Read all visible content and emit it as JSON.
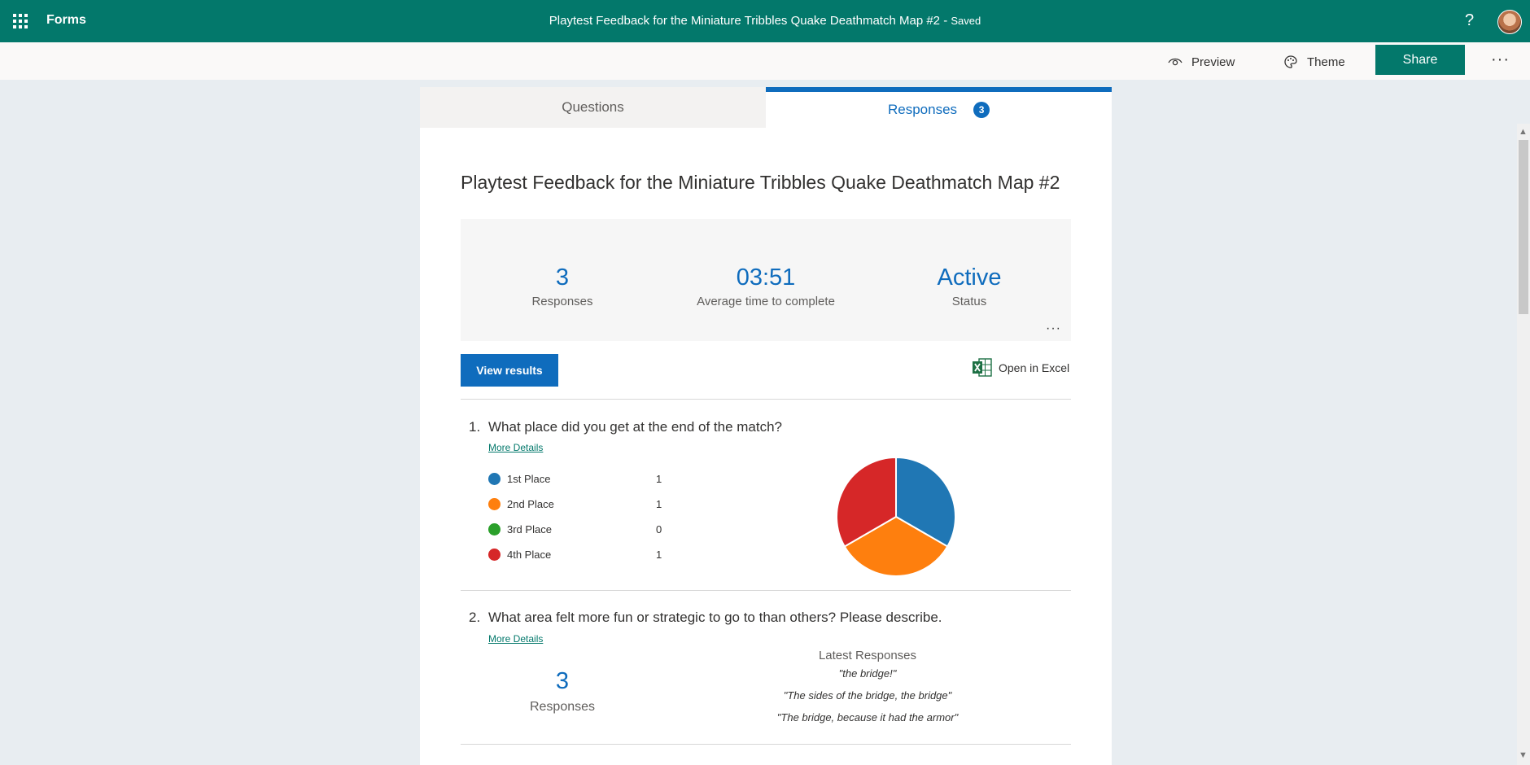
{
  "topbar": {
    "app_name": "Forms",
    "form_title": "Playtest Feedback for the Miniature Tribbles Quake Deathmatch Map #2",
    "save_status": "Saved",
    "help_label": "?"
  },
  "commandbar": {
    "preview_label": "Preview",
    "theme_label": "Theme",
    "share_label": "Share",
    "more_label": "···"
  },
  "tabs": {
    "questions_label": "Questions",
    "responses_label": "Responses",
    "responses_badge": "3"
  },
  "summary": {
    "title": "Playtest Feedback for the Miniature Tribbles Quake Deathmatch Map #2",
    "responses_count": "3",
    "responses_label": "Responses",
    "avg_time": "03:51",
    "avg_time_label": "Average time to complete",
    "status": "Active",
    "status_label": "Status",
    "more_label": "···",
    "view_results_label": "View results",
    "open_excel_label": "Open in Excel"
  },
  "questions": [
    {
      "number": "1.",
      "text": "What place did you get at the end of the match?",
      "more_details": "More Details",
      "options": [
        {
          "label": "1st Place",
          "count": "1",
          "color": "#2077b4"
        },
        {
          "label": "2nd Place",
          "count": "1",
          "color": "#fe7f0e"
        },
        {
          "label": "3rd Place",
          "count": "0",
          "color": "#2ba02b"
        },
        {
          "label": "4th Place",
          "count": "1",
          "color": "#d62728"
        }
      ]
    },
    {
      "number": "2.",
      "text": "What area felt more fun or strategic to go to than others? Please describe.",
      "more_details": "More Details",
      "response_count": "3",
      "response_label": "Responses",
      "latest_heading": "Latest Responses",
      "latest": [
        "\"the bridge!\"",
        "\"The sides of the bridge, the bridge\"",
        "\"The bridge, because it had the armor\""
      ]
    }
  ],
  "chart_data": {
    "type": "pie",
    "categories": [
      "1st Place",
      "2nd Place",
      "3rd Place",
      "4th Place"
    ],
    "values": [
      1,
      1,
      0,
      1
    ],
    "colors": [
      "#2077b4",
      "#fe7f0e",
      "#2ba02b",
      "#d62728"
    ]
  },
  "icons": {
    "waffle": "app-launcher-icon",
    "preview": "eye-icon",
    "theme": "palette-icon",
    "excel": "excel-icon"
  }
}
